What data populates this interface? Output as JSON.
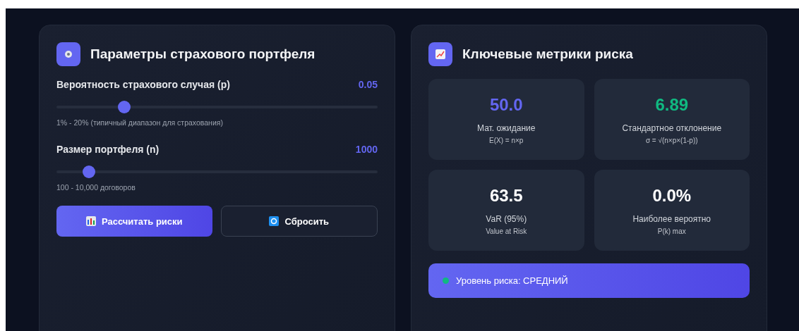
{
  "params_panel": {
    "title": "Параметры страхового портфеля",
    "sliders": [
      {
        "label": "Вероятность страхового случая (p)",
        "value": "0.05",
        "level": 0.21,
        "hint": "1% - 20% (типичный диапазон для страхования)"
      },
      {
        "label": "Размер портфеля (n)",
        "value": "1000",
        "level": 0.1,
        "hint": "100 - 10,000 договоров"
      }
    ],
    "buttons": [
      {
        "label": "Рассчитать риски",
        "kind": "primary"
      },
      {
        "label": "Сбросить",
        "kind": "secondary"
      }
    ]
  },
  "metrics_panel": {
    "title": "Ключевые метрики риска",
    "metrics": [
      {
        "value": "50.0",
        "color": "#6366f1",
        "label": "Мат. ожидание",
        "formula": "E(X) = n×p"
      },
      {
        "value": "6.89",
        "color": "#10b981",
        "label": "Стандартное отклонение",
        "formula": "σ = √(n×p×(1-p))"
      },
      {
        "value": "63.5",
        "color": "#ffffff",
        "label": "VaR (95%)",
        "formula": "Value at Risk"
      },
      {
        "value": "0.0%",
        "color": "#ffffff",
        "label": "Наиболее вероятно",
        "formula": "P(k) max"
      }
    ],
    "risk_level": {
      "text": "Уровень риска: СРЕДНИЙ",
      "color": "#10b981"
    }
  }
}
